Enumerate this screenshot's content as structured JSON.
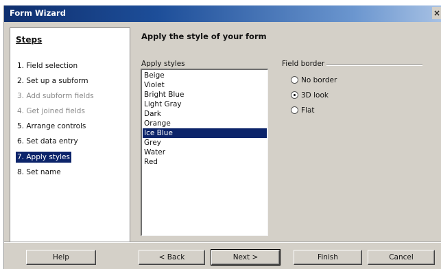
{
  "window": {
    "title": "Form Wizard",
    "close_glyph": "×"
  },
  "steps": {
    "header": "Steps",
    "items": [
      {
        "label": "1. Field selection",
        "state": "normal"
      },
      {
        "label": "2. Set up a subform",
        "state": "normal"
      },
      {
        "label": "3. Add subform fields",
        "state": "disabled"
      },
      {
        "label": "4. Get joined fields",
        "state": "disabled"
      },
      {
        "label": "5. Arrange controls",
        "state": "normal"
      },
      {
        "label": "6. Set data entry",
        "state": "normal"
      },
      {
        "label": "7. Apply styles",
        "state": "active"
      },
      {
        "label": "8. Set name",
        "state": "normal"
      }
    ]
  },
  "main": {
    "heading": "Apply the style of your form",
    "styles_label": "Apply styles",
    "styles": [
      "Beige",
      "Violet",
      "Bright Blue",
      "Light Gray",
      "Dark",
      "Orange",
      "Ice Blue",
      "Grey",
      "Water",
      "Red"
    ],
    "selected_style": "Ice Blue",
    "field_border": {
      "label": "Field border",
      "options": [
        "No border",
        "3D look",
        "Flat"
      ],
      "selected": "3D look"
    }
  },
  "buttons": {
    "help": "Help",
    "back": "< Back",
    "next": "Next >",
    "finish": "Finish",
    "cancel": "Cancel"
  }
}
